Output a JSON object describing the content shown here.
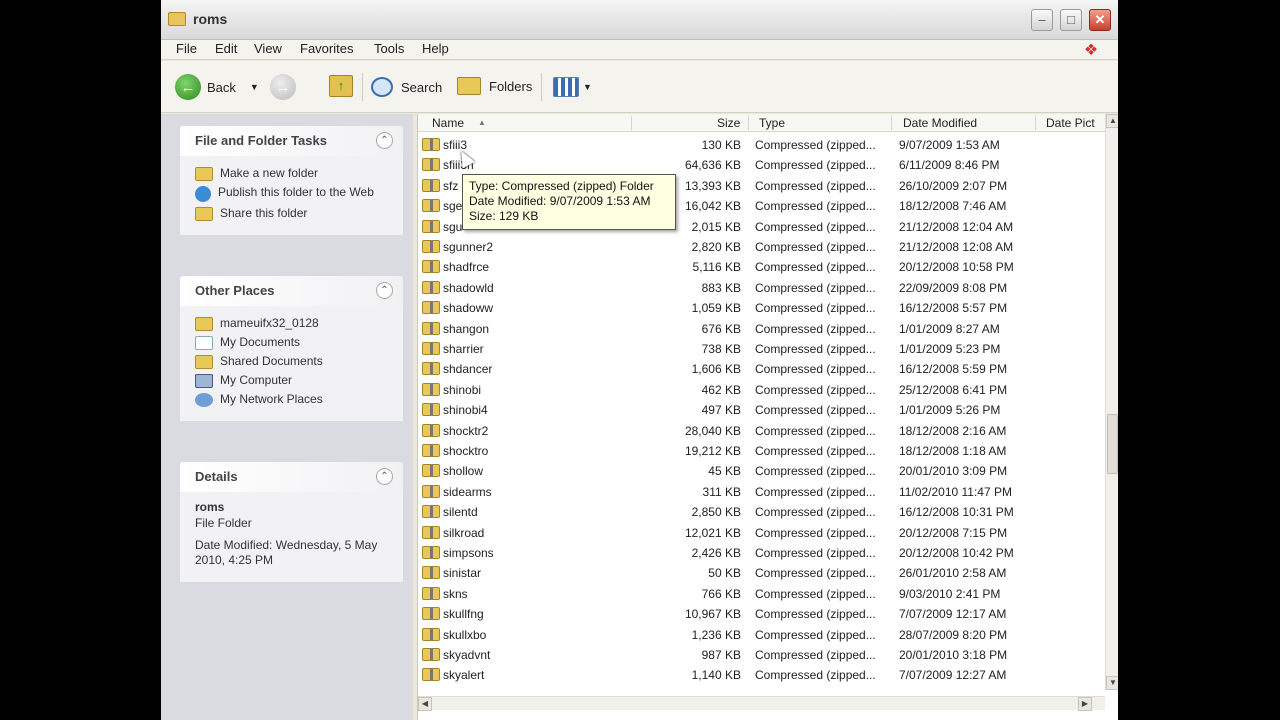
{
  "window": {
    "title": "roms",
    "controls": {
      "minimize": "–",
      "maximize": "□",
      "close": "✕"
    }
  },
  "menu": [
    "File",
    "Edit",
    "View",
    "Favorites",
    "Tools",
    "Help"
  ],
  "toolbar": {
    "back": "Back",
    "search": "Search",
    "folders": "Folders"
  },
  "tasks": {
    "title": "File and Folder Tasks",
    "items": [
      {
        "label": "Make a new folder",
        "icon": "new-folder-icon"
      },
      {
        "label": "Publish this folder to the Web",
        "icon": "globe-icon"
      },
      {
        "label": "Share this folder",
        "icon": "share-folder-icon"
      }
    ]
  },
  "places": {
    "title": "Other Places",
    "items": [
      {
        "label": "mameuifx32_0128",
        "icon": "folder-icon"
      },
      {
        "label": "My Documents",
        "icon": "documents-icon"
      },
      {
        "label": "Shared Documents",
        "icon": "folder-icon"
      },
      {
        "label": "My Computer",
        "icon": "computer-icon"
      },
      {
        "label": "My Network Places",
        "icon": "network-icon"
      }
    ]
  },
  "details": {
    "title": "Details",
    "name": "roms",
    "kind": "File Folder",
    "modified": "Date Modified: Wednesday, 5 May 2010, 4:25 PM"
  },
  "columns": {
    "name": "Name",
    "size": "Size",
    "type": "Type",
    "date_modified": "Date Modified",
    "date_picture": "Date Pict"
  },
  "files": [
    {
      "name": "sfiii3",
      "size": "130 KB",
      "type": "Compressed (zipped...",
      "date": "9/07/2009 1:53 AM"
    },
    {
      "name": "sfiii3n",
      "size": "64,636 KB",
      "type": "Compressed (zipped...",
      "date": "6/11/2009 8:46 PM"
    },
    {
      "name": "sfz",
      "size": "13,393 KB",
      "type": "Compressed (zipped...",
      "date": "26/10/2009 2:07 PM"
    },
    {
      "name": "sge",
      "size": "16,042 KB",
      "type": "Compressed (zipped...",
      "date": "18/12/2008 7:46 AM"
    },
    {
      "name": "sgu",
      "size": "2,015 KB",
      "type": "Compressed (zipped...",
      "date": "21/12/2008 12:04 AM"
    },
    {
      "name": "sgunner2",
      "size": "2,820 KB",
      "type": "Compressed (zipped...",
      "date": "21/12/2008 12:08 AM"
    },
    {
      "name": "shadfrce",
      "size": "5,116 KB",
      "type": "Compressed (zipped...",
      "date": "20/12/2008 10:58 PM"
    },
    {
      "name": "shadowld",
      "size": "883 KB",
      "type": "Compressed (zipped...",
      "date": "22/09/2009 8:08 PM"
    },
    {
      "name": "shadoww",
      "size": "1,059 KB",
      "type": "Compressed (zipped...",
      "date": "16/12/2008 5:57 PM"
    },
    {
      "name": "shangon",
      "size": "676 KB",
      "type": "Compressed (zipped...",
      "date": "1/01/2009 8:27 AM"
    },
    {
      "name": "sharrier",
      "size": "738 KB",
      "type": "Compressed (zipped...",
      "date": "1/01/2009 5:23 PM"
    },
    {
      "name": "shdancer",
      "size": "1,606 KB",
      "type": "Compressed (zipped...",
      "date": "16/12/2008 5:59 PM"
    },
    {
      "name": "shinobi",
      "size": "462 KB",
      "type": "Compressed (zipped...",
      "date": "25/12/2008 6:41 PM"
    },
    {
      "name": "shinobi4",
      "size": "497 KB",
      "type": "Compressed (zipped...",
      "date": "1/01/2009 5:26 PM"
    },
    {
      "name": "shocktr2",
      "size": "28,040 KB",
      "type": "Compressed (zipped...",
      "date": "18/12/2008 2:16 AM"
    },
    {
      "name": "shocktro",
      "size": "19,212 KB",
      "type": "Compressed (zipped...",
      "date": "18/12/2008 1:18 AM"
    },
    {
      "name": "shollow",
      "size": "45 KB",
      "type": "Compressed (zipped...",
      "date": "20/01/2010 3:09 PM"
    },
    {
      "name": "sidearms",
      "size": "311 KB",
      "type": "Compressed (zipped...",
      "date": "11/02/2010 11:47 PM"
    },
    {
      "name": "silentd",
      "size": "2,850 KB",
      "type": "Compressed (zipped...",
      "date": "16/12/2008 10:31 PM"
    },
    {
      "name": "silkroad",
      "size": "12,021 KB",
      "type": "Compressed (zipped...",
      "date": "20/12/2008 7:15 PM"
    },
    {
      "name": "simpsons",
      "size": "2,426 KB",
      "type": "Compressed (zipped...",
      "date": "20/12/2008 10:42 PM"
    },
    {
      "name": "sinistar",
      "size": "50 KB",
      "type": "Compressed (zipped...",
      "date": "26/01/2010 2:58 AM"
    },
    {
      "name": "skns",
      "size": "766 KB",
      "type": "Compressed (zipped...",
      "date": "9/03/2010 2:41 PM"
    },
    {
      "name": "skullfng",
      "size": "10,967 KB",
      "type": "Compressed (zipped...",
      "date": "7/07/2009 12:17 AM"
    },
    {
      "name": "skullxbo",
      "size": "1,236 KB",
      "type": "Compressed (zipped...",
      "date": "28/07/2009 8:20 PM"
    },
    {
      "name": "skyadvnt",
      "size": "987 KB",
      "type": "Compressed (zipped...",
      "date": "20/01/2010 3:18 PM"
    },
    {
      "name": "skyalert",
      "size": "1,140 KB",
      "type": "Compressed (zipped...",
      "date": "7/07/2009 12:27 AM"
    }
  ],
  "tooltip": {
    "type": "Type: Compressed (zipped) Folder",
    "date": "Date Modified: 9/07/2009 1:53 AM",
    "size": "Size: 129 KB"
  }
}
